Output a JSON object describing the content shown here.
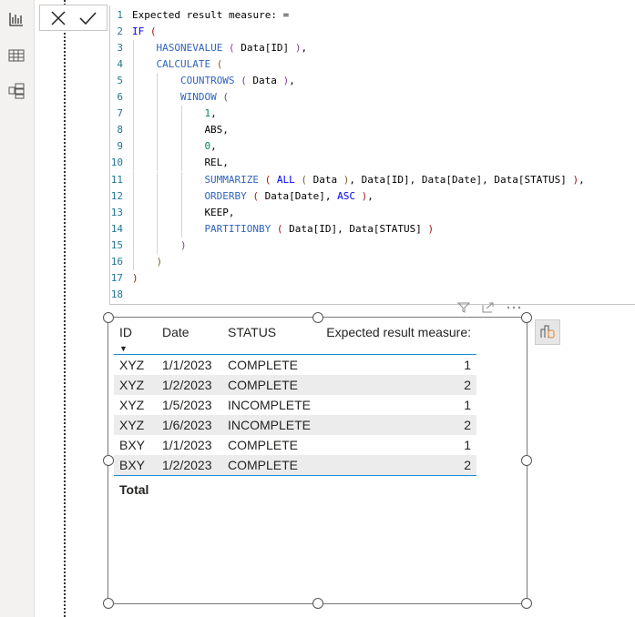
{
  "sidebar": {
    "items": [
      {
        "icon": "report-view-icon"
      },
      {
        "icon": "table-view-icon"
      },
      {
        "icon": "model-view-icon"
      }
    ]
  },
  "formula_bar": {
    "cancel_icon": "close-icon",
    "commit_icon": "check-icon"
  },
  "colors": {
    "function": "#3165bb",
    "keyword": "#0000ff",
    "number": "#098658",
    "text": "#000000",
    "paren1": "#a31515",
    "paren2": "#795e26",
    "paren3": "#7b3f9e",
    "line_number": "#237893",
    "accent": "#1a8cd8"
  },
  "code": [
    {
      "n": "1",
      "indent": 0,
      "tokens": [
        [
          "Expected result measure: =",
          "text"
        ]
      ]
    },
    {
      "n": "2",
      "indent": 0,
      "tokens": [
        [
          "IF",
          "keyword"
        ],
        [
          " ",
          "text"
        ],
        [
          "(",
          "paren1"
        ]
      ]
    },
    {
      "n": "3",
      "indent": 1,
      "tokens": [
        [
          "HASONEVALUE",
          "function"
        ],
        [
          " ",
          "text"
        ],
        [
          "(",
          "paren3"
        ],
        [
          " Data[ID] ",
          "text"
        ],
        [
          ")",
          "paren3"
        ],
        [
          ",",
          "text"
        ]
      ]
    },
    {
      "n": "4",
      "indent": 1,
      "tokens": [
        [
          "CALCULATE",
          "function"
        ],
        [
          " ",
          "text"
        ],
        [
          "(",
          "paren2"
        ]
      ]
    },
    {
      "n": "5",
      "indent": 2,
      "tokens": [
        [
          "COUNTROWS",
          "function"
        ],
        [
          " ",
          "text"
        ],
        [
          "(",
          "paren3"
        ],
        [
          " Data ",
          "text"
        ],
        [
          ")",
          "paren3"
        ],
        [
          ",",
          "text"
        ]
      ]
    },
    {
      "n": "6",
      "indent": 2,
      "tokens": [
        [
          "WINDOW",
          "function"
        ],
        [
          " ",
          "text"
        ],
        [
          "(",
          "paren3"
        ]
      ]
    },
    {
      "n": "7",
      "indent": 3,
      "tokens": [
        [
          "1",
          "number"
        ],
        [
          ",",
          "text"
        ]
      ]
    },
    {
      "n": "8",
      "indent": 3,
      "tokens": [
        [
          "ABS,",
          "text"
        ]
      ]
    },
    {
      "n": "9",
      "indent": 3,
      "tokens": [
        [
          "0",
          "number"
        ],
        [
          ",",
          "text"
        ]
      ]
    },
    {
      "n": "10",
      "indent": 3,
      "tokens": [
        [
          "REL,",
          "text"
        ]
      ]
    },
    {
      "n": "11",
      "indent": 3,
      "tokens": [
        [
          "SUMMARIZE",
          "function"
        ],
        [
          " ",
          "text"
        ],
        [
          "(",
          "paren1"
        ],
        [
          " ",
          "text"
        ],
        [
          "ALL",
          "keyword"
        ],
        [
          " ",
          "text"
        ],
        [
          "(",
          "paren2"
        ],
        [
          " Data ",
          "text"
        ],
        [
          ")",
          "paren2"
        ],
        [
          ", Data[ID], Data[Date], Data[STATUS] ",
          "text"
        ],
        [
          ")",
          "paren1"
        ],
        [
          ",",
          "text"
        ]
      ]
    },
    {
      "n": "12",
      "indent": 3,
      "tokens": [
        [
          "ORDERBY",
          "function"
        ],
        [
          " ",
          "text"
        ],
        [
          "(",
          "paren1"
        ],
        [
          " Data[Date], ",
          "text"
        ],
        [
          "ASC",
          "keyword"
        ],
        [
          " ",
          "text"
        ],
        [
          ")",
          "paren1"
        ],
        [
          ",",
          "text"
        ]
      ]
    },
    {
      "n": "13",
      "indent": 3,
      "tokens": [
        [
          "KEEP,",
          "text"
        ]
      ]
    },
    {
      "n": "14",
      "indent": 3,
      "tokens": [
        [
          "PARTITIONBY",
          "function"
        ],
        [
          " ",
          "text"
        ],
        [
          "(",
          "paren1"
        ],
        [
          " Data[ID], Data[STATUS] ",
          "text"
        ],
        [
          ")",
          "paren1"
        ]
      ]
    },
    {
      "n": "15",
      "indent": 2,
      "tokens": [
        [
          ")",
          "paren3"
        ]
      ]
    },
    {
      "n": "16",
      "indent": 1,
      "tokens": [
        [
          ")",
          "paren2"
        ]
      ]
    },
    {
      "n": "17",
      "indent": 0,
      "tokens": [
        [
          ")",
          "paren1"
        ]
      ]
    },
    {
      "n": "18",
      "indent": 0,
      "tokens": []
    }
  ],
  "visual_header": {
    "icons": [
      "filter-icon",
      "focus-mode-icon",
      "more-options-icon"
    ]
  },
  "table": {
    "columns": [
      "ID",
      "Date",
      "STATUS",
      "Expected result measure:"
    ],
    "sort_column": "ID",
    "sort_direction": "descending",
    "rows": [
      [
        "XYZ",
        "1/1/2023",
        "COMPLETE",
        "1"
      ],
      [
        "XYZ",
        "1/2/2023",
        "COMPLETE",
        "2"
      ],
      [
        "XYZ",
        "1/5/2023",
        "INCOMPLETE",
        "1"
      ],
      [
        "XYZ",
        "1/6/2023",
        "INCOMPLETE",
        "2"
      ],
      [
        "BXY",
        "1/1/2023",
        "COMPLETE",
        "1"
      ],
      [
        "BXY",
        "1/2/2023",
        "COMPLETE",
        "2"
      ]
    ],
    "total_label": "Total"
  }
}
